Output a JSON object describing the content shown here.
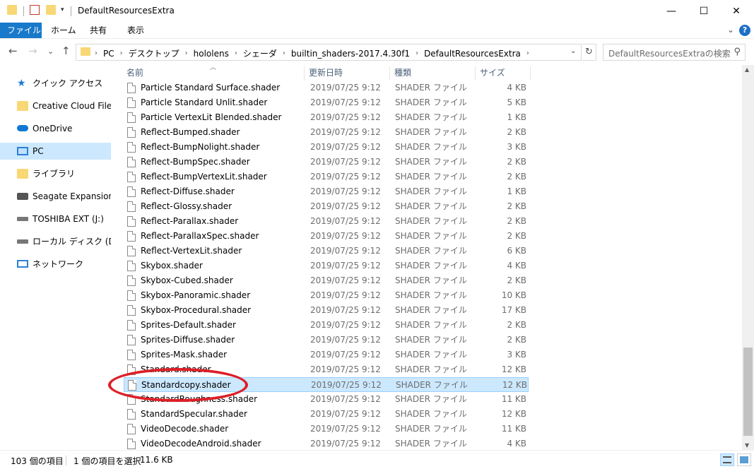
{
  "window": {
    "title": "DefaultResourcesExtra",
    "minimize_glyph": "—",
    "maximize_glyph": "☐",
    "close_glyph": "✕"
  },
  "ribbon": {
    "tabs": [
      "ファイル",
      "ホーム",
      "共有",
      "表示"
    ],
    "help_glyph": "?",
    "collapse_glyph": "⌄"
  },
  "address": {
    "crumbs": [
      "PC",
      "デスクトップ",
      "hololens",
      "シェーダ",
      "builtin_shaders-2017.4.30f1",
      "DefaultResourcesExtra"
    ],
    "back_glyph": "←",
    "forward_glyph": "→",
    "recent_glyph": "⌄",
    "up_glyph": "↑",
    "dropdown_glyph": "⌄",
    "refresh_glyph": "↻"
  },
  "search": {
    "placeholder": "DefaultResourcesExtraの検索",
    "icon_glyph": "⚲"
  },
  "nav": {
    "items": [
      {
        "label": "クイック アクセス",
        "icon": "star-icon"
      },
      {
        "label": "Creative Cloud Files",
        "icon": "creative-cloud-icon"
      },
      {
        "label": "OneDrive",
        "icon": "cloud-icon"
      },
      {
        "label": "PC",
        "icon": "pc-icon",
        "selected": true
      },
      {
        "label": "ライブラリ",
        "icon": "library-icon"
      },
      {
        "label": "Seagate Expansion Dr",
        "icon": "drive-icon"
      },
      {
        "label": "TOSHIBA EXT (J:)",
        "icon": "drive-icon"
      },
      {
        "label": "ローカル ディスク (D:)",
        "icon": "drive-icon"
      },
      {
        "label": "ネットワーク",
        "icon": "network-icon"
      }
    ]
  },
  "columns": {
    "name": "名前",
    "date": "更新日時",
    "type": "種類",
    "size": "サイズ"
  },
  "files": [
    {
      "name": "Particle Standard Surface.shader",
      "date": "2019/07/25 9:12",
      "type": "SHADER ファイル",
      "size": "4 KB"
    },
    {
      "name": "Particle Standard Unlit.shader",
      "date": "2019/07/25 9:12",
      "type": "SHADER ファイル",
      "size": "5 KB"
    },
    {
      "name": "Particle VertexLit Blended.shader",
      "date": "2019/07/25 9:12",
      "type": "SHADER ファイル",
      "size": "1 KB"
    },
    {
      "name": "Reflect-Bumped.shader",
      "date": "2019/07/25 9:12",
      "type": "SHADER ファイル",
      "size": "2 KB"
    },
    {
      "name": "Reflect-BumpNolight.shader",
      "date": "2019/07/25 9:12",
      "type": "SHADER ファイル",
      "size": "3 KB"
    },
    {
      "name": "Reflect-BumpSpec.shader",
      "date": "2019/07/25 9:12",
      "type": "SHADER ファイル",
      "size": "2 KB"
    },
    {
      "name": "Reflect-BumpVertexLit.shader",
      "date": "2019/07/25 9:12",
      "type": "SHADER ファイル",
      "size": "2 KB"
    },
    {
      "name": "Reflect-Diffuse.shader",
      "date": "2019/07/25 9:12",
      "type": "SHADER ファイル",
      "size": "1 KB"
    },
    {
      "name": "Reflect-Glossy.shader",
      "date": "2019/07/25 9:12",
      "type": "SHADER ファイル",
      "size": "2 KB"
    },
    {
      "name": "Reflect-Parallax.shader",
      "date": "2019/07/25 9:12",
      "type": "SHADER ファイル",
      "size": "2 KB"
    },
    {
      "name": "Reflect-ParallaxSpec.shader",
      "date": "2019/07/25 9:12",
      "type": "SHADER ファイル",
      "size": "2 KB"
    },
    {
      "name": "Reflect-VertexLit.shader",
      "date": "2019/07/25 9:12",
      "type": "SHADER ファイル",
      "size": "6 KB"
    },
    {
      "name": "Skybox.shader",
      "date": "2019/07/25 9:12",
      "type": "SHADER ファイル",
      "size": "4 KB"
    },
    {
      "name": "Skybox-Cubed.shader",
      "date": "2019/07/25 9:12",
      "type": "SHADER ファイル",
      "size": "2 KB"
    },
    {
      "name": "Skybox-Panoramic.shader",
      "date": "2019/07/25 9:12",
      "type": "SHADER ファイル",
      "size": "10 KB"
    },
    {
      "name": "Skybox-Procedural.shader",
      "date": "2019/07/25 9:12",
      "type": "SHADER ファイル",
      "size": "17 KB"
    },
    {
      "name": "Sprites-Default.shader",
      "date": "2019/07/25 9:12",
      "type": "SHADER ファイル",
      "size": "2 KB"
    },
    {
      "name": "Sprites-Diffuse.shader",
      "date": "2019/07/25 9:12",
      "type": "SHADER ファイル",
      "size": "2 KB"
    },
    {
      "name": "Sprites-Mask.shader",
      "date": "2019/07/25 9:12",
      "type": "SHADER ファイル",
      "size": "3 KB"
    },
    {
      "name": "Standard.shader",
      "date": "2019/07/25 9:12",
      "type": "SHADER ファイル",
      "size": "12 KB"
    },
    {
      "name": "Standardcopy.shader",
      "date": "2019/07/25 9:12",
      "type": "SHADER ファイル",
      "size": "12 KB",
      "selected": true
    },
    {
      "name": "StandardRoughness.shader",
      "date": "2019/07/25 9:12",
      "type": "SHADER ファイル",
      "size": "11 KB"
    },
    {
      "name": "StandardSpecular.shader",
      "date": "2019/07/25 9:12",
      "type": "SHADER ファイル",
      "size": "12 KB"
    },
    {
      "name": "VideoDecode.shader",
      "date": "2019/07/25 9:12",
      "type": "SHADER ファイル",
      "size": "11 KB"
    },
    {
      "name": "VideoDecodeAndroid.shader",
      "date": "2019/07/25 9:12",
      "type": "SHADER ファイル",
      "size": "4 KB"
    }
  ],
  "status": {
    "item_count": "103 個の項目",
    "selection": "1 個の項目を選択",
    "selection_size": "11.6 KB"
  },
  "colors": {
    "accent": "#1979ca",
    "selection": "#cce8ff",
    "annotation": "#dd1f26"
  }
}
